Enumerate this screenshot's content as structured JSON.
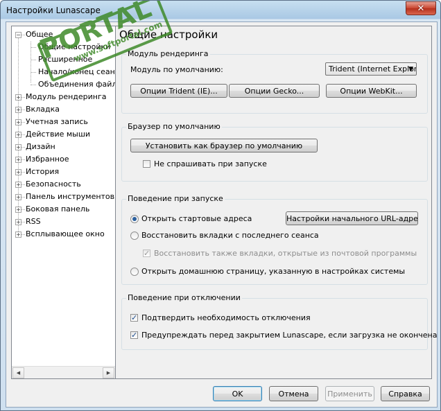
{
  "window": {
    "title": "Настройки Lunascape",
    "close_glyph": "✕"
  },
  "tree": {
    "items": [
      {
        "label": "Общее",
        "level": 0,
        "expander": "−"
      },
      {
        "label": "Общие настройки",
        "level": 1
      },
      {
        "label": "Расширенное",
        "level": 1
      },
      {
        "label": "Начало/конец сеанса",
        "level": 1
      },
      {
        "label": "Объединения файлов",
        "level": 1
      },
      {
        "label": "Модуль рендеринга",
        "level": 0,
        "expander": "+"
      },
      {
        "label": "Вкладка",
        "level": 0,
        "expander": "+"
      },
      {
        "label": "Учетная запись",
        "level": 0,
        "expander": "+"
      },
      {
        "label": "Действие мыши",
        "level": 0,
        "expander": "+"
      },
      {
        "label": "Дизайн",
        "level": 0,
        "expander": "+"
      },
      {
        "label": "Избранное",
        "level": 0,
        "expander": "+"
      },
      {
        "label": "История",
        "level": 0,
        "expander": "+"
      },
      {
        "label": "Безопасность",
        "level": 0,
        "expander": "+"
      },
      {
        "label": "Панель инструментов",
        "level": 0,
        "expander": "+"
      },
      {
        "label": "Боковая панель",
        "level": 0,
        "expander": "+"
      },
      {
        "label": "RSS",
        "level": 0,
        "expander": "+"
      },
      {
        "label": "Всплывающее окно",
        "level": 0,
        "expander": "+"
      }
    ],
    "scroll_left": "◀",
    "scroll_right": "▶"
  },
  "panel": {
    "title": "Общие настройки",
    "render": {
      "label": "Модуль рендеринга",
      "default_label": "Модуль по умолчанию:",
      "default_value": "Trident (Internet Explorer)",
      "btn_trident": "Опции Trident (IE)...",
      "btn_gecko": "Опции Gecko...",
      "btn_webkit": "Опции WebKit..."
    },
    "default_browser": {
      "label": "Браузер по умолчанию",
      "set_button": "Установить как браузер по умолчанию",
      "no_ask": "Не спрашивать при запуске"
    },
    "startup": {
      "label": "Поведение при запуске",
      "open_start": "Открыть стартовые адреса",
      "url_button": "Настройки начального URL-адреса",
      "restore_tabs": "Восстановить вкладки с последнего сеанса",
      "restore_mail": "Восстановить также вкладки, открытые из почтовой программы",
      "open_home": "Открыть домашнюю страницу, указанную в настройках системы"
    },
    "shutdown": {
      "label": "Поведение при отключении",
      "confirm": "Подтвердить необходимость отключения",
      "warn": "Предупреждать перед закрытием Lunascape, если загрузка не окончена"
    }
  },
  "footer": {
    "ok": "OK",
    "cancel": "Отмена",
    "apply": "Применить",
    "help": "Справка"
  },
  "watermark": {
    "brand": "PORTAL",
    "tm": "™",
    "url": "www.softportal.com"
  },
  "icons": {
    "check": "✓",
    "dropdown": "▼"
  },
  "colors": {
    "accent": "#3c7fb1",
    "watermark": "#3f8a2a"
  }
}
